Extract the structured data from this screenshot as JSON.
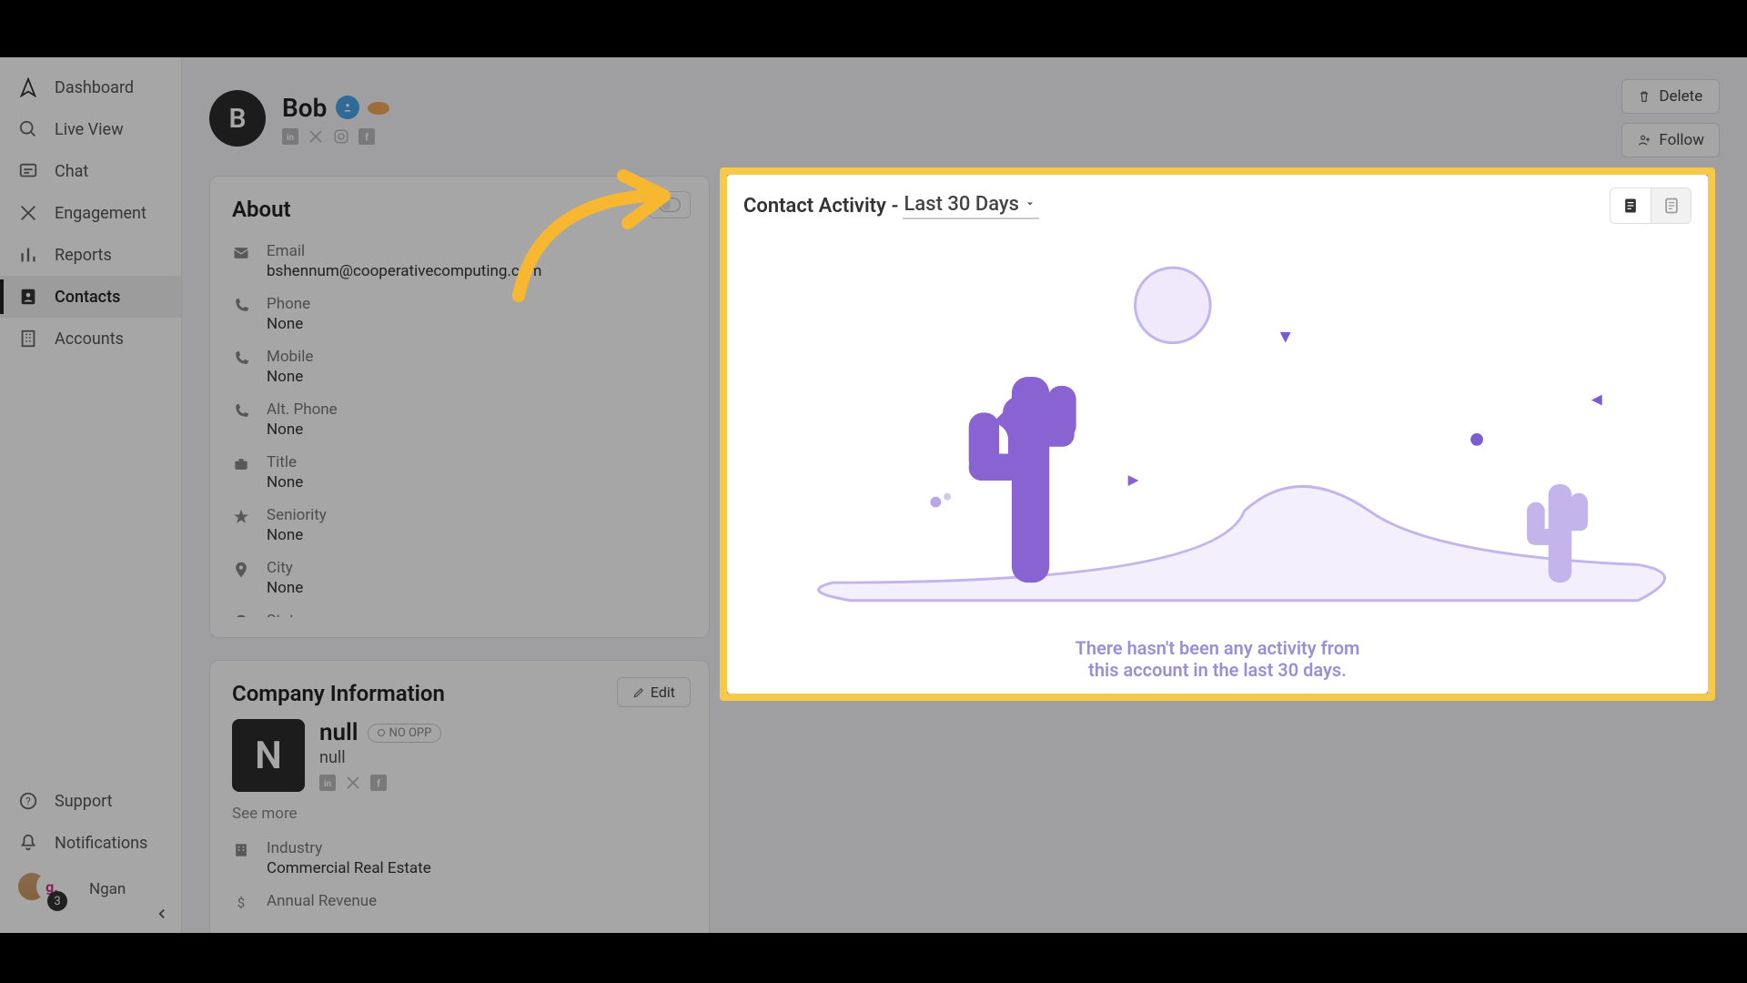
{
  "sidebar": {
    "items": [
      {
        "label": "Dashboard"
      },
      {
        "label": "Live View"
      },
      {
        "label": "Chat"
      },
      {
        "label": "Engagement"
      },
      {
        "label": "Reports"
      },
      {
        "label": "Contacts"
      },
      {
        "label": "Accounts"
      }
    ],
    "support": "Support",
    "notifications": "Notifications",
    "user_name": "Ngan",
    "notif_count": "3",
    "avatar_letter": "g."
  },
  "contact": {
    "avatar_letter": "B",
    "name": "Bob"
  },
  "header_actions": {
    "delete": "Delete",
    "follow": "Follow"
  },
  "about": {
    "title": "About",
    "fields": {
      "email": {
        "label": "Email",
        "value": "bshennum@cooperativecomputing.com"
      },
      "phone": {
        "label": "Phone",
        "value": "None"
      },
      "mobile": {
        "label": "Mobile",
        "value": "None"
      },
      "altphone": {
        "label": "Alt. Phone",
        "value": "None"
      },
      "title": {
        "label": "Title",
        "value": "None"
      },
      "seniority": {
        "label": "Seniority",
        "value": "None"
      },
      "city": {
        "label": "City",
        "value": "None"
      },
      "state": {
        "label": "State",
        "value": ""
      }
    }
  },
  "company": {
    "title": "Company Information",
    "edit": "Edit",
    "avatar_letter": "N",
    "name": "null",
    "subname": "null",
    "noopp": "NO OPP",
    "see_more": "See more",
    "industry": {
      "label": "Industry",
      "value": "Commercial Real Estate"
    },
    "revenue": {
      "label": "Annual Revenue"
    }
  },
  "activity": {
    "title_prefix": "Contact Activity - ",
    "range": "Last 30 Days",
    "empty_line1": "There hasn't been any activity from",
    "empty_line2": "this account in the last 30 days."
  }
}
